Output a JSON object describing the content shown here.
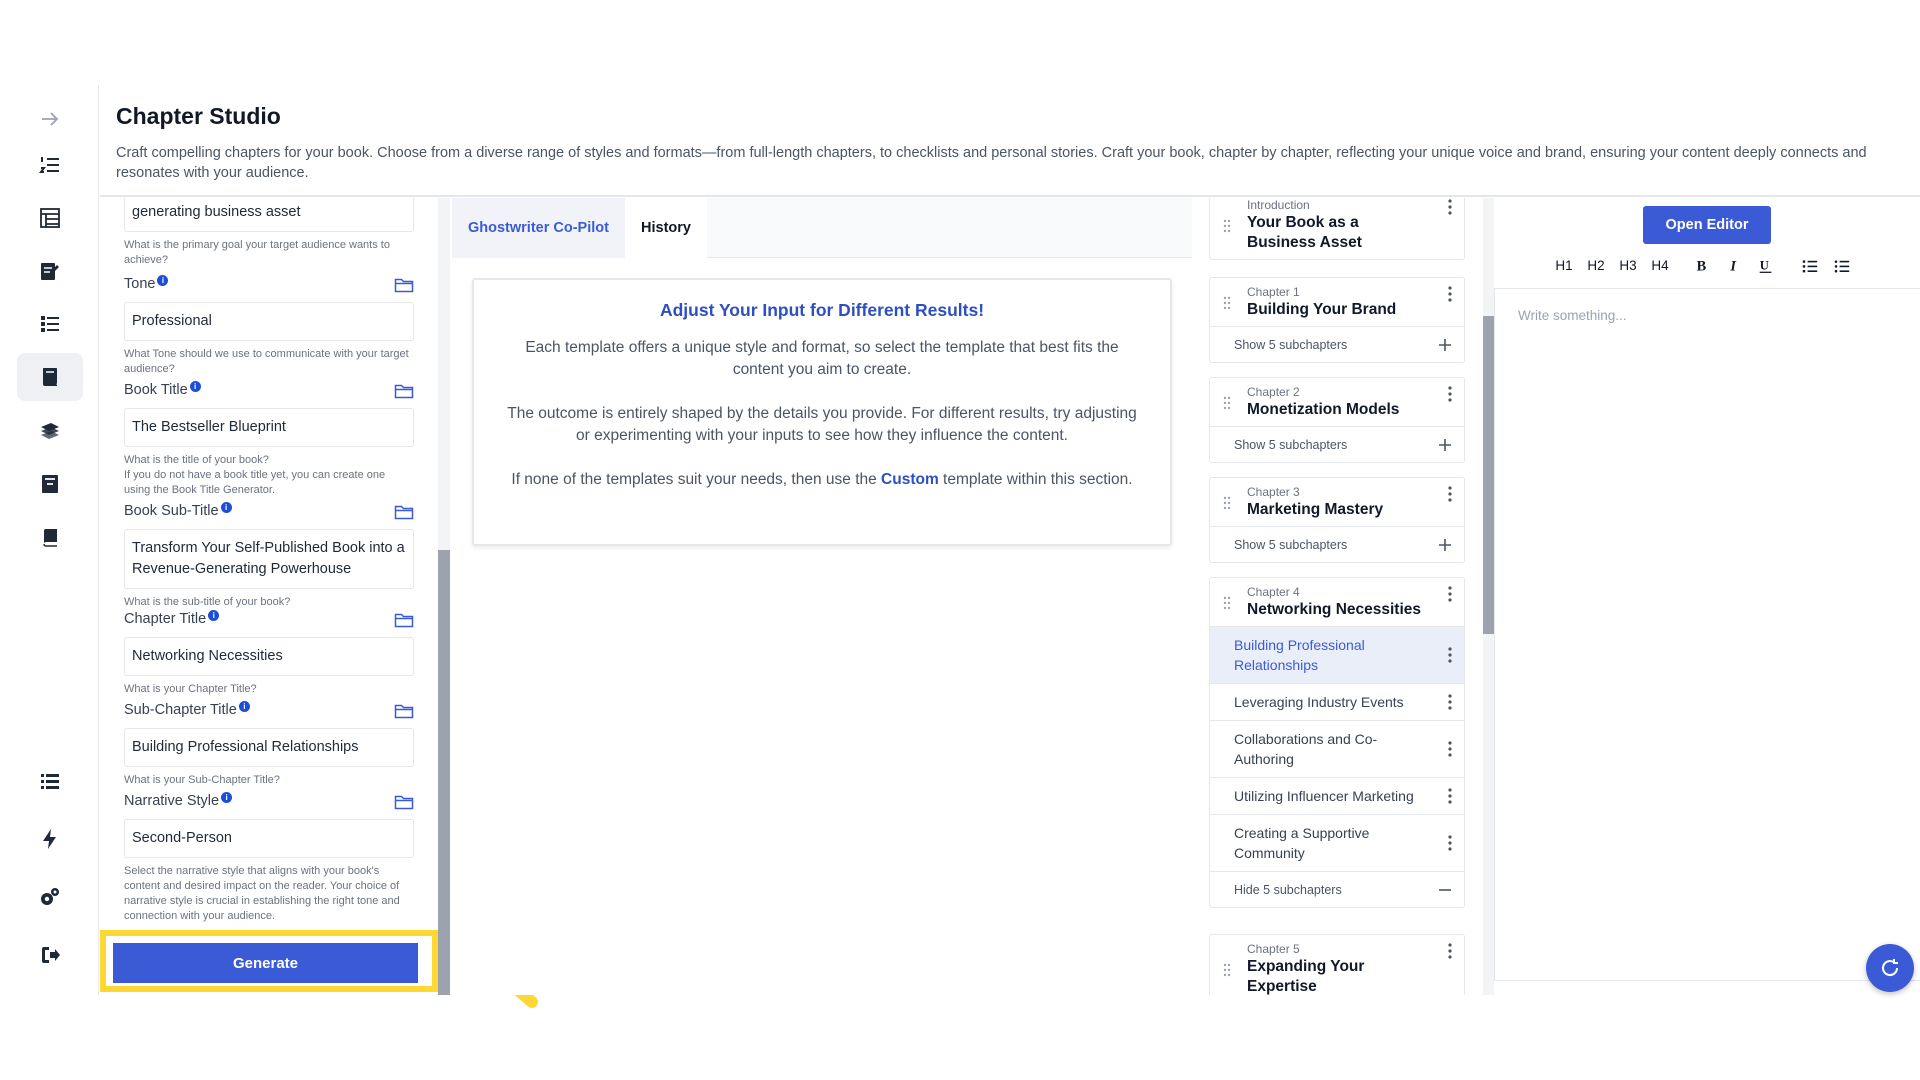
{
  "page": {
    "title": "Chapter Studio",
    "description": "Craft compelling chapters for your book. Choose from a diverse range of styles and formats—from full-length chapters, to checklists and personal stories. Craft your book, chapter by chapter, reflecting your unique voice and brand, ensuring your content deeply connects and resonates with your audience."
  },
  "rail": {
    "icons": [
      "arrow-right-icon",
      "numbered-list-icon",
      "table-icon",
      "edit-document-icon",
      "checklist-icon",
      "book-template-icon",
      "books-icon",
      "archive-icon",
      "book-icon",
      "list-icon",
      "lightning-icon",
      "settings-icon",
      "logout-icon"
    ]
  },
  "form": {
    "top_field": {
      "value": "generating business asset",
      "help": "What is the primary goal your target audience wants to achieve?"
    },
    "tone": {
      "label": "Tone",
      "value": "Professional",
      "help": "What Tone should we use to communicate with your target audience?"
    },
    "book_title": {
      "label": "Book Title",
      "value": "The Bestseller Blueprint",
      "help": "What is the title of your book?",
      "help2": "If you do not have a book title yet, you can create one using the Book Title Generator."
    },
    "book_subtitle": {
      "label": "Book Sub-Title",
      "value": "Transform Your Self-Published Book into a Revenue-Generating Powerhouse",
      "help": "What is the sub-title of your book?"
    },
    "chapter_title": {
      "label": "Chapter Title",
      "value": "Networking Necessities",
      "help": "What is your Chapter Title?"
    },
    "subchapter_title": {
      "label": "Sub-Chapter Title",
      "value": "Building Professional Relationships",
      "help": "What is your Sub-Chapter Title?"
    },
    "narrative_style": {
      "label": "Narrative Style",
      "value": "Second-Person",
      "help": "Select the narrative style that aligns with your book's content and desired impact on the reader. Your choice of narrative style is crucial in establishing the right tone and connection with your audience."
    },
    "generate_label": "Generate"
  },
  "copilot": {
    "tab_copilot": "Ghostwriter Co-Pilot",
    "tab_history": "History",
    "notice_title": "Adjust Your Input for Different Results!",
    "p1": "Each template offers a unique style and format, so select the template that best fits the content you aim to create.",
    "p2": "The outcome is entirely shaped by the details you provide. For different results, try adjusting or experimenting with your inputs to see how they influence the content.",
    "p3_before": "If none of the templates suit your needs, then use the ",
    "p3_link": "Custom",
    "p3_after": " template within this section."
  },
  "chapters": {
    "intro": {
      "kicker": "Introduction",
      "name": "Your Book as a Business Asset"
    },
    "ch1": {
      "kicker": "Chapter 1",
      "name": "Building Your Brand",
      "toggle": "Show 5 subchapters"
    },
    "ch2": {
      "kicker": "Chapter 2",
      "name": "Monetization Models",
      "toggle": "Show 5 subchapters"
    },
    "ch3": {
      "kicker": "Chapter 3",
      "name": "Marketing Mastery",
      "toggle": "Show 5 subchapters"
    },
    "ch4": {
      "kicker": "Chapter 4",
      "name": "Networking Necessities",
      "subs": [
        "Building Professional Relationships",
        "Leveraging Industry Events",
        "Collaborations and Co-Authoring",
        "Utilizing Influencer Marketing",
        "Creating a Supportive Community"
      ],
      "toggle": "Hide 5 subchapters"
    },
    "ch5": {
      "kicker": "Chapter 5",
      "name": "Expanding Your Expertise"
    }
  },
  "editor": {
    "open_label": "Open Editor",
    "toolbar": [
      "H1",
      "H2",
      "H3",
      "H4"
    ],
    "placeholder": "Write something..."
  },
  "colors": {
    "accent": "#3b5bd6",
    "highlight": "#fdd835"
  }
}
